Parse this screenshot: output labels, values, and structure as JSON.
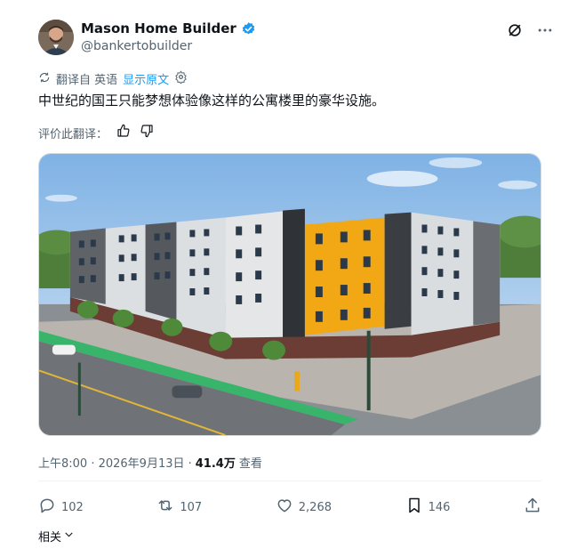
{
  "author": {
    "display_name": "Mason Home Builder",
    "handle": "@bankertobuilder"
  },
  "translation": {
    "translated_from": "翻译自 英语",
    "show_original": "显示原文"
  },
  "tweet": {
    "text": "中世纪的国王只能梦想体验像这样的公寓楼里的豪华设施。"
  },
  "rating": {
    "label": "评价此翻译："
  },
  "meta": {
    "timestamp": "上午8:00 · 2026年9月13日 · ",
    "views_count": "41.4万",
    "views_label": "查看"
  },
  "stats": {
    "replies": "102",
    "reposts": "107",
    "likes": "2,268",
    "bookmarks": "146"
  },
  "footer": {
    "related": "相关"
  },
  "colors": {
    "accent": "#1d9bf0",
    "text_secondary": "#536471",
    "divider": "#eff3f4"
  },
  "icons": [
    "grok-icon",
    "more-icon",
    "translate-icon",
    "settings-icon",
    "thumbs-up-icon",
    "thumbs-down-icon",
    "reply-icon",
    "repost-icon",
    "like-icon",
    "bookmark-icon",
    "share-icon",
    "chevron-down-icon",
    "verified-badge-icon"
  ]
}
